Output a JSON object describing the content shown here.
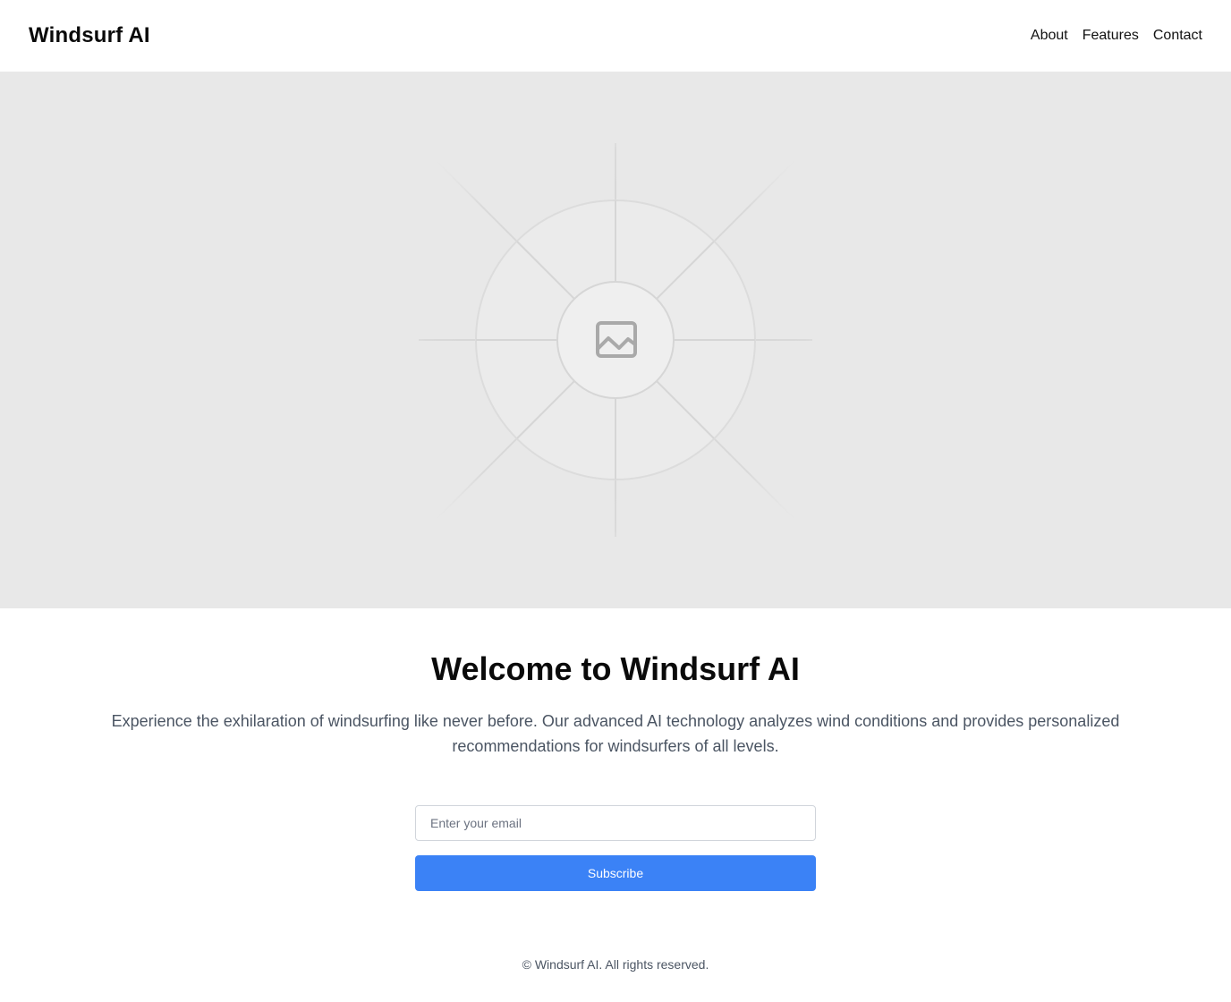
{
  "header": {
    "brand": "Windsurf AI",
    "nav": [
      {
        "label": "About"
      },
      {
        "label": "Features"
      },
      {
        "label": "Contact"
      }
    ]
  },
  "hero": {
    "icon": "image-placeholder-icon"
  },
  "main": {
    "headline": "Welcome to Windsurf AI",
    "description": "Experience the exhilaration of windsurfing like never before. Our advanced AI technology analyzes wind conditions and provides personalized recommendations for windsurfers of all levels."
  },
  "form": {
    "email_placeholder": "Enter your email",
    "email_value": "",
    "subscribe_label": "Subscribe"
  },
  "footer": {
    "text": "© Windsurf AI. All rights reserved."
  },
  "colors": {
    "accent": "#3b82f6",
    "hero_bg": "#e8e8e8",
    "body_text": "#4b5563"
  }
}
